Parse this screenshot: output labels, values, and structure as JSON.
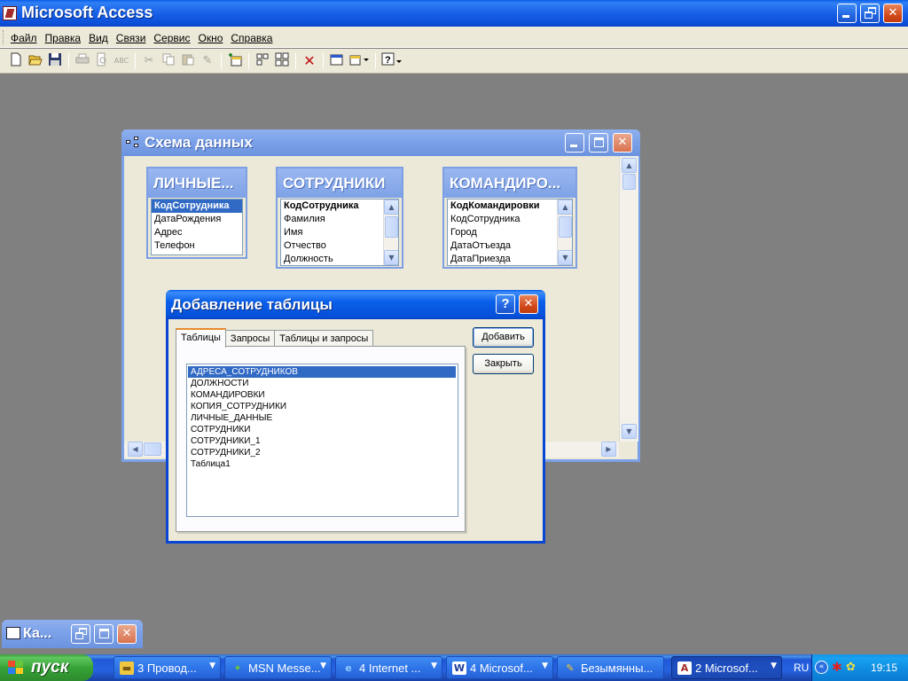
{
  "app": {
    "title": "Microsoft Access"
  },
  "menu": [
    "Файл",
    "Правка",
    "Вид",
    "Связи",
    "Сервис",
    "Окно",
    "Справка"
  ],
  "toolbar": {
    "icons": [
      "new-icon",
      "open-icon",
      "save-icon",
      "print-icon",
      "print-preview-icon",
      "spelling-icon",
      "cut-icon",
      "copy-icon",
      "paste-icon",
      "format-painter-icon",
      "show-table-icon",
      "show-direct-icon",
      "show-all-icon",
      "delete-icon",
      "new-object-icon",
      "help-icon"
    ]
  },
  "schema_window": {
    "title": "Схема данных",
    "tables": [
      {
        "header": "ЛИЧНЫЕ...",
        "fields": [
          "КодСотрудника",
          "ДатаРождения",
          "Адрес",
          "Телефон"
        ],
        "selected": 0
      },
      {
        "header": "СОТРУДНИКИ",
        "fields": [
          "КодСотрудника",
          "Фамилия",
          "Имя",
          "Отчество",
          "Должность"
        ],
        "primary": 0
      },
      {
        "header": "КОМАНДИРО...",
        "fields": [
          "КодКомандировки",
          "КодСотрудника",
          "Город",
          "ДатаОтъезда",
          "ДатаПриезда"
        ],
        "primary": 0
      }
    ]
  },
  "dialog": {
    "title": "Добавление таблицы",
    "help": "?",
    "tabs": [
      "Таблицы",
      "Запросы",
      "Таблицы и запросы"
    ],
    "active_tab": 0,
    "items": [
      "АДРЕСА_СОТРУДНИКОВ",
      "ДОЛЖНОСТИ",
      "КОМАНДИРОВКИ",
      "КОПИЯ_СОТРУДНИКИ",
      "ЛИЧНЫЕ_ДАННЫЕ",
      "СОТРУДНИКИ",
      "СОТРУДНИКИ_1",
      "СОТРУДНИКИ_2",
      "Таблица1"
    ],
    "selected_item": 0,
    "add_label": "Добавить",
    "close_label": "Закрыть"
  },
  "minimized_window": {
    "title": "Ка..."
  },
  "taskbar": {
    "start_label": "пуск",
    "tasks": [
      {
        "label": "3 Провод...",
        "icon": "folder-icon",
        "has_arrow": true,
        "active": false
      },
      {
        "label": "MSN Messe...",
        "icon": "msn-icon",
        "has_arrow": true,
        "active": false
      },
      {
        "label": "4 Internet ...",
        "icon": "ie-icon",
        "has_arrow": true,
        "active": false
      },
      {
        "label": "4 Microsof...",
        "icon": "word-icon",
        "has_arrow": true,
        "active": false
      },
      {
        "label": "Безымянны...",
        "icon": "paint-icon",
        "has_arrow": false,
        "active": false
      },
      {
        "label": "2 Microsof...",
        "icon": "access-icon",
        "has_arrow": true,
        "active": true
      }
    ],
    "language": "RU",
    "clock": "19:15"
  }
}
